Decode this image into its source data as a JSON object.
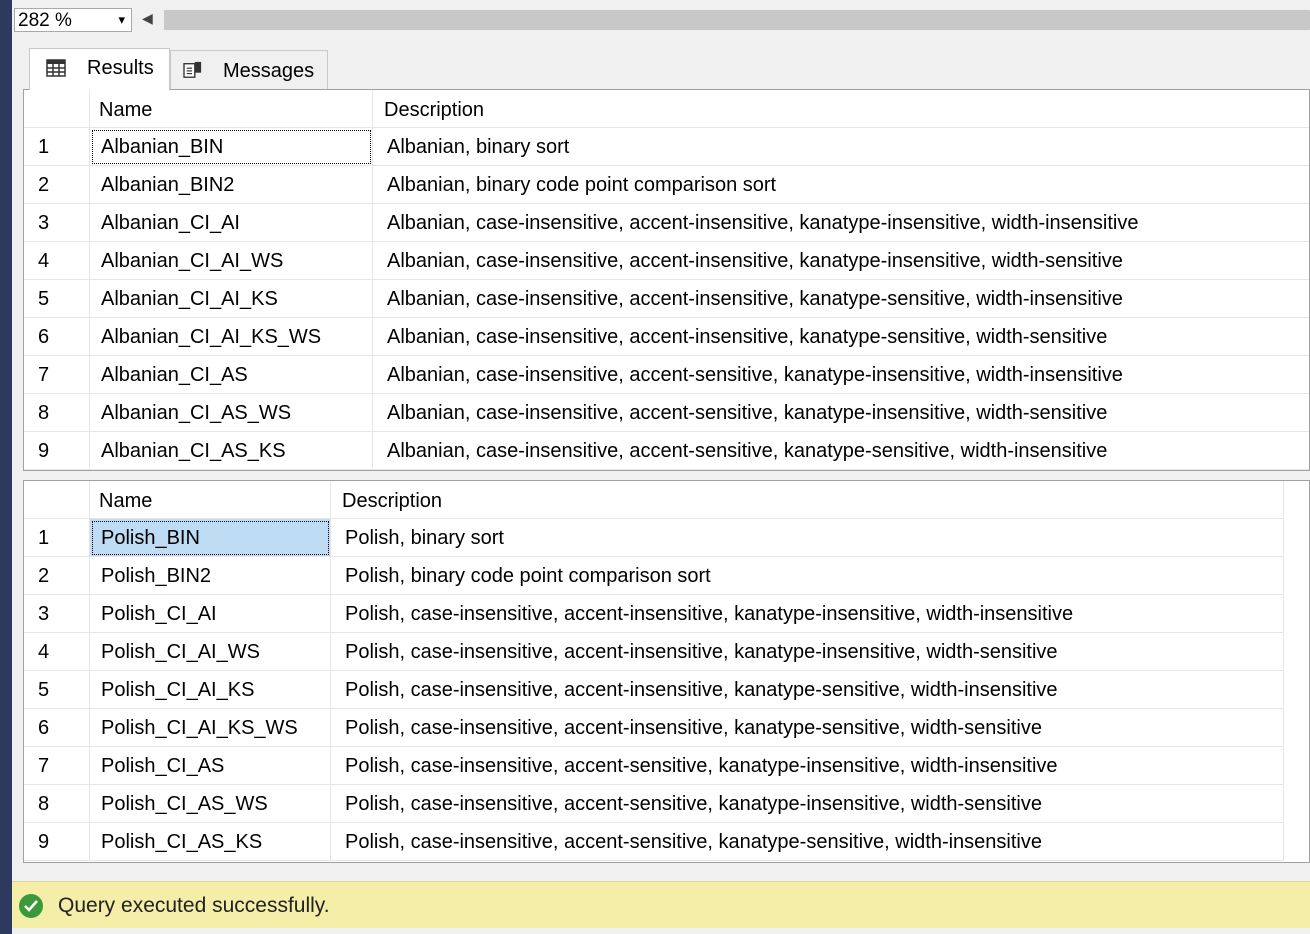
{
  "toolbar": {
    "zoom_value": "282 %",
    "zoom_arrow": "▾",
    "scroll_left_arrow": "◀"
  },
  "tabs": {
    "results": {
      "label": "Results",
      "icon": "grid-icon"
    },
    "messages": {
      "label": "Messages",
      "icon": "messages-icon"
    }
  },
  "grid1": {
    "headers": {
      "name": "Name",
      "description": "Description"
    },
    "rows": [
      {
        "num": "1",
        "name": "Albanian_BIN",
        "description": "Albanian, binary sort"
      },
      {
        "num": "2",
        "name": "Albanian_BIN2",
        "description": "Albanian, binary code point comparison sort"
      },
      {
        "num": "3",
        "name": "Albanian_CI_AI",
        "description": "Albanian, case-insensitive, accent-insensitive, kanatype-insensitive, width-insensitive"
      },
      {
        "num": "4",
        "name": "Albanian_CI_AI_WS",
        "description": "Albanian, case-insensitive, accent-insensitive, kanatype-insensitive, width-sensitive"
      },
      {
        "num": "5",
        "name": "Albanian_CI_AI_KS",
        "description": "Albanian, case-insensitive, accent-insensitive, kanatype-sensitive, width-insensitive"
      },
      {
        "num": "6",
        "name": "Albanian_CI_AI_KS_WS",
        "description": "Albanian, case-insensitive, accent-insensitive, kanatype-sensitive, width-sensitive"
      },
      {
        "num": "7",
        "name": "Albanian_CI_AS",
        "description": "Albanian, case-insensitive, accent-sensitive, kanatype-insensitive, width-insensitive"
      },
      {
        "num": "8",
        "name": "Albanian_CI_AS_WS",
        "description": "Albanian, case-insensitive, accent-sensitive, kanatype-insensitive, width-sensitive"
      },
      {
        "num": "9",
        "name": "Albanian_CI_AS_KS",
        "description": "Albanian, case-insensitive, accent-sensitive, kanatype-sensitive, width-insensitive"
      }
    ]
  },
  "grid2": {
    "headers": {
      "name": "Name",
      "description": "Description"
    },
    "rows": [
      {
        "num": "1",
        "name": "Polish_BIN",
        "description": "Polish, binary sort"
      },
      {
        "num": "2",
        "name": "Polish_BIN2",
        "description": "Polish, binary code point comparison sort"
      },
      {
        "num": "3",
        "name": "Polish_CI_AI",
        "description": "Polish, case-insensitive, accent-insensitive, kanatype-insensitive, width-insensitive"
      },
      {
        "num": "4",
        "name": "Polish_CI_AI_WS",
        "description": "Polish, case-insensitive, accent-insensitive, kanatype-insensitive, width-sensitive"
      },
      {
        "num": "5",
        "name": "Polish_CI_AI_KS",
        "description": "Polish, case-insensitive, accent-insensitive, kanatype-sensitive, width-insensitive"
      },
      {
        "num": "6",
        "name": "Polish_CI_AI_KS_WS",
        "description": "Polish, case-insensitive, accent-insensitive, kanatype-sensitive, width-sensitive"
      },
      {
        "num": "7",
        "name": "Polish_CI_AS",
        "description": "Polish, case-insensitive, accent-sensitive, kanatype-insensitive, width-insensitive"
      },
      {
        "num": "8",
        "name": "Polish_CI_AS_WS",
        "description": "Polish, case-insensitive, accent-sensitive, kanatype-insensitive, width-sensitive"
      },
      {
        "num": "9",
        "name": "Polish_CI_AS_KS",
        "description": "Polish, case-insensitive, accent-sensitive, kanatype-sensitive, width-insensitive"
      }
    ]
  },
  "status": {
    "text": "Query executed successfully.",
    "icon": "success-check-icon",
    "color": "#f5eea8"
  },
  "colors": {
    "selected_cell": "#bfdcf5",
    "window_border": "#2d3a5e",
    "success_green": "#3a9a3a"
  }
}
